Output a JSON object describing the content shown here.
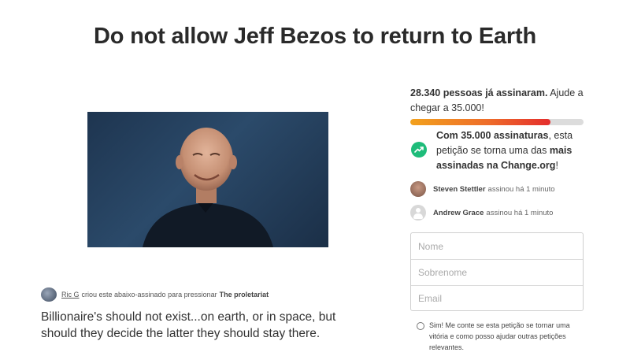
{
  "petition": {
    "title": "Do not allow Jeff Bezos to return to Earth",
    "creator": {
      "name": "Ric G",
      "action_text": "criou este abaixo-assinado para pressionar",
      "target": "The proletariat"
    },
    "description": "Billionaire's should not exist...on earth, or in space, but should they decide the latter they should stay there."
  },
  "sidebar": {
    "signed_count_bold": "28.340 pessoas já assinaram.",
    "signed_count_rest": " Ajude a chegar a 35.000!",
    "progress_fraction": 0.81,
    "goal": {
      "bold1": "Com 35.000 assinaturas",
      "text1": ", esta petição se torna uma das ",
      "bold2": "mais assinadas na Change.org",
      "text2": "!"
    },
    "recent_signers": [
      {
        "name": "Steven Stettler",
        "text": "assinou há 1 minuto"
      },
      {
        "name": "Andrew Grace",
        "text": "assinou há 1 minuto"
      }
    ],
    "form": {
      "first_name_placeholder": "Nome",
      "last_name_placeholder": "Sobrenome",
      "email_placeholder": "Email"
    },
    "optin_text": "Sim! Me conte se esta petição se tornar uma vitória e como posso ajudar outras petições relevantes."
  },
  "colors": {
    "progress_start": "#f2a11d",
    "progress_end": "#e42d2d",
    "goal_icon": "#1ebc7a"
  },
  "icons": {
    "goal": "trending-up-icon"
  }
}
